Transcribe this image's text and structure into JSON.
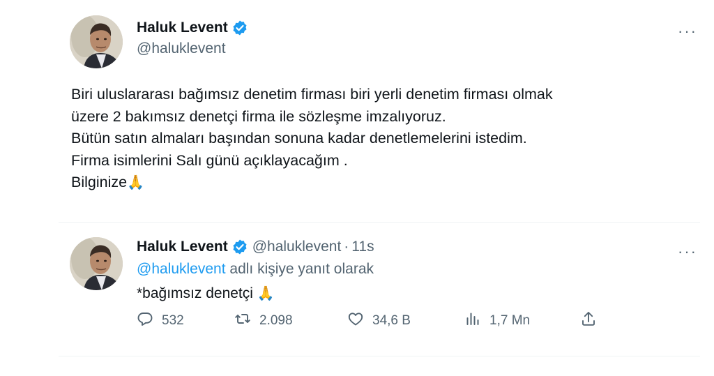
{
  "main_tweet": {
    "display_name": "Haluk Levent",
    "handle": "@halukl​event",
    "lines": [
      "Biri uluslararası bağımsız denetim firması biri yerli denetim firması olmak",
      "üzere 2 bakımsız denetçi firma ile sözleşme imzalıyoruz.",
      "Bütün satın almaları başından sonuna kadar denetlemelerini istedim.",
      "Firma isimlerini Salı günü açıklayacağım .",
      "Bilginize"
    ],
    "emoji": "🙏",
    "more": "···"
  },
  "reply_tweet": {
    "display_name": "Haluk Levent",
    "handle": "@halukl​event",
    "dot": "·",
    "time": "11s",
    "reply_mention": "@halukl​event",
    "reply_suffix": " adlı kişiye yanıt olarak",
    "text": "*bağımsız denetçi ",
    "emoji": "🙏",
    "more": "···",
    "actions": {
      "replies": "532",
      "retweets": "2.098",
      "likes": "34,6 B",
      "views": "1,7 Mn"
    }
  },
  "icons": {
    "verified": "verified-badge-icon",
    "reply": "reply-icon",
    "retweet": "retweet-icon",
    "like": "heart-icon",
    "views": "views-icon",
    "share": "share-icon"
  },
  "colors": {
    "text": "#0f1419",
    "secondary": "#536471",
    "accent": "#1d9bf0",
    "divider": "#eff3f4"
  }
}
